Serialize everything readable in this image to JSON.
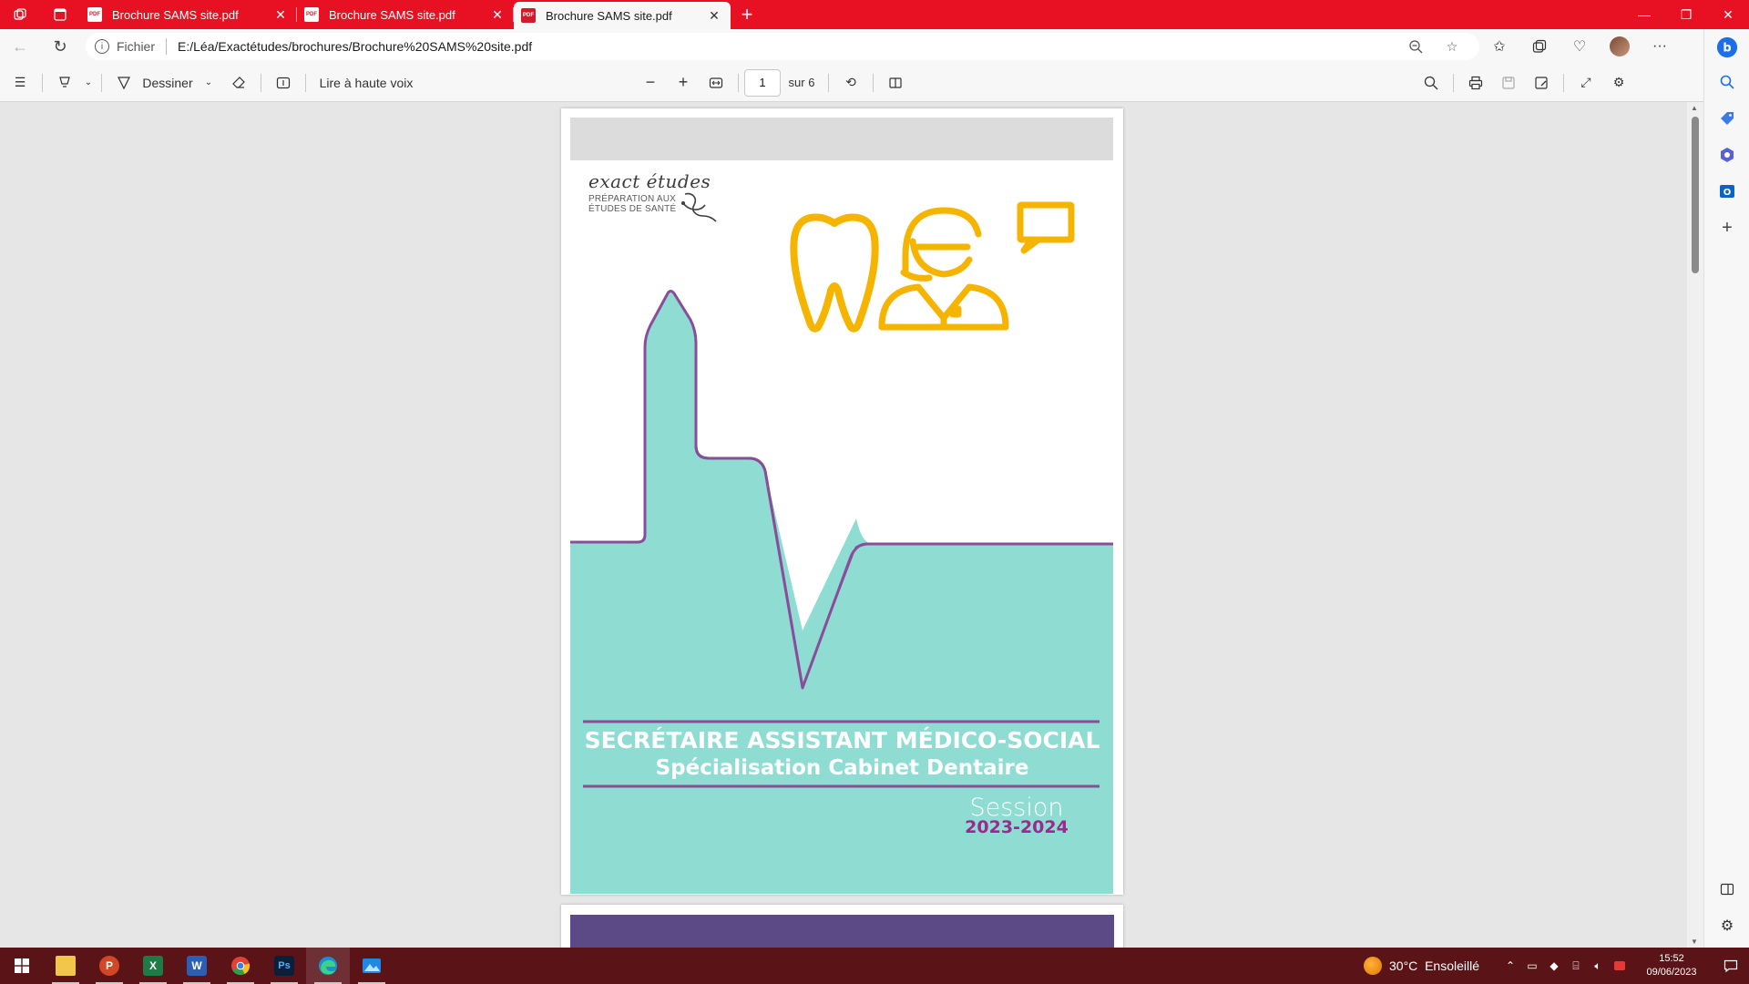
{
  "browser": {
    "tabs": [
      {
        "title": "Brochure SAMS site.pdf",
        "active": false
      },
      {
        "title": "Brochure SAMS site.pdf",
        "active": false
      },
      {
        "title": "Brochure SAMS site.pdf",
        "active": true
      }
    ],
    "address": {
      "scheme_label": "Fichier",
      "url": "E:/Léa/Exactétudes/brochures/Brochure%20SAMS%20site.pdf"
    }
  },
  "pdf_toolbar": {
    "draw_label": "Dessiner",
    "read_aloud_label": "Lire à haute voix",
    "page_current": "1",
    "page_total_label": "sur 6"
  },
  "document": {
    "logo": {
      "brand": "exact études",
      "line1": "PRÉPARATION AUX",
      "line2": "ÉTUDES DE SANTÉ"
    },
    "title_line1": "SECRÉTAIRE ASSISTANT MÉDICO-SOCIAL",
    "title_line2": "Spécialisation Cabinet Dentaire",
    "session_label": "Session",
    "session_years": "2023-2024",
    "colors": {
      "teal": "#8edcd2",
      "purple": "#8a4d9a",
      "gold": "#f5b400",
      "grey_band": "#dcdcdc",
      "next_page_band": "#5b4a86"
    }
  },
  "taskbar": {
    "weather": "30°C  Ensoleillé",
    "time": "15:52",
    "date": "09/06/2023"
  },
  "theme": {
    "titlebar": "#e81123",
    "taskbar": "#5a1418"
  }
}
